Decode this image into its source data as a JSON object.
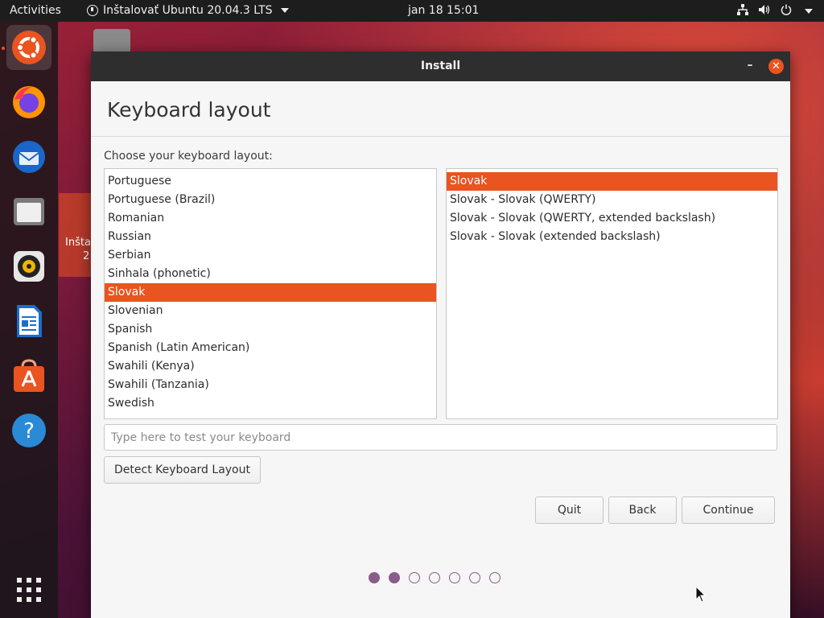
{
  "topbar": {
    "activities": "Activities",
    "app_menu": "Inštalovať Ubuntu 20.04.3 LTS",
    "clock": "jan 18  15:01",
    "icons": [
      "network-icon",
      "volume-icon",
      "power-icon",
      "chevron-down-icon"
    ]
  },
  "dock": {
    "items": [
      "ubuntu-installer-icon",
      "firefox-icon",
      "thunderbird-icon",
      "files-icon",
      "rhythmbox-icon",
      "libreoffice-writer-icon",
      "ubuntu-software-icon",
      "help-icon",
      "show-applications-icon"
    ]
  },
  "desktop": {
    "install_icon_label_1": "Inšta",
    "install_icon_label_2": "2"
  },
  "window": {
    "title": "Install",
    "minimize": "–",
    "close": "✕"
  },
  "page": {
    "title": "Keyboard layout",
    "choose_label": "Choose your keyboard layout:",
    "layouts": [
      {
        "label": "Portuguese",
        "selected": false
      },
      {
        "label": "Portuguese (Brazil)",
        "selected": false
      },
      {
        "label": "Romanian",
        "selected": false
      },
      {
        "label": "Russian",
        "selected": false
      },
      {
        "label": "Serbian",
        "selected": false
      },
      {
        "label": "Sinhala (phonetic)",
        "selected": false
      },
      {
        "label": "Slovak",
        "selected": true
      },
      {
        "label": "Slovenian",
        "selected": false
      },
      {
        "label": "Spanish",
        "selected": false
      },
      {
        "label": "Spanish (Latin American)",
        "selected": false
      },
      {
        "label": "Swahili (Kenya)",
        "selected": false
      },
      {
        "label": "Swahili (Tanzania)",
        "selected": false
      },
      {
        "label": "Swedish",
        "selected": false
      }
    ],
    "variants": [
      {
        "label": "Slovak",
        "selected": true
      },
      {
        "label": "Slovak - Slovak (QWERTY)",
        "selected": false
      },
      {
        "label": "Slovak - Slovak (QWERTY, extended backslash)",
        "selected": false
      },
      {
        "label": "Slovak - Slovak (extended backslash)",
        "selected": false
      }
    ],
    "test_placeholder": "Type here to test your keyboard",
    "test_value": "",
    "detect_button": "Detect Keyboard Layout",
    "quit_button": "Quit",
    "back_button": "Back",
    "continue_button": "Continue",
    "progress": {
      "total": 7,
      "completed": 2
    }
  },
  "colors": {
    "accent": "#e95420",
    "progress_dot": "#8a5c8c"
  }
}
